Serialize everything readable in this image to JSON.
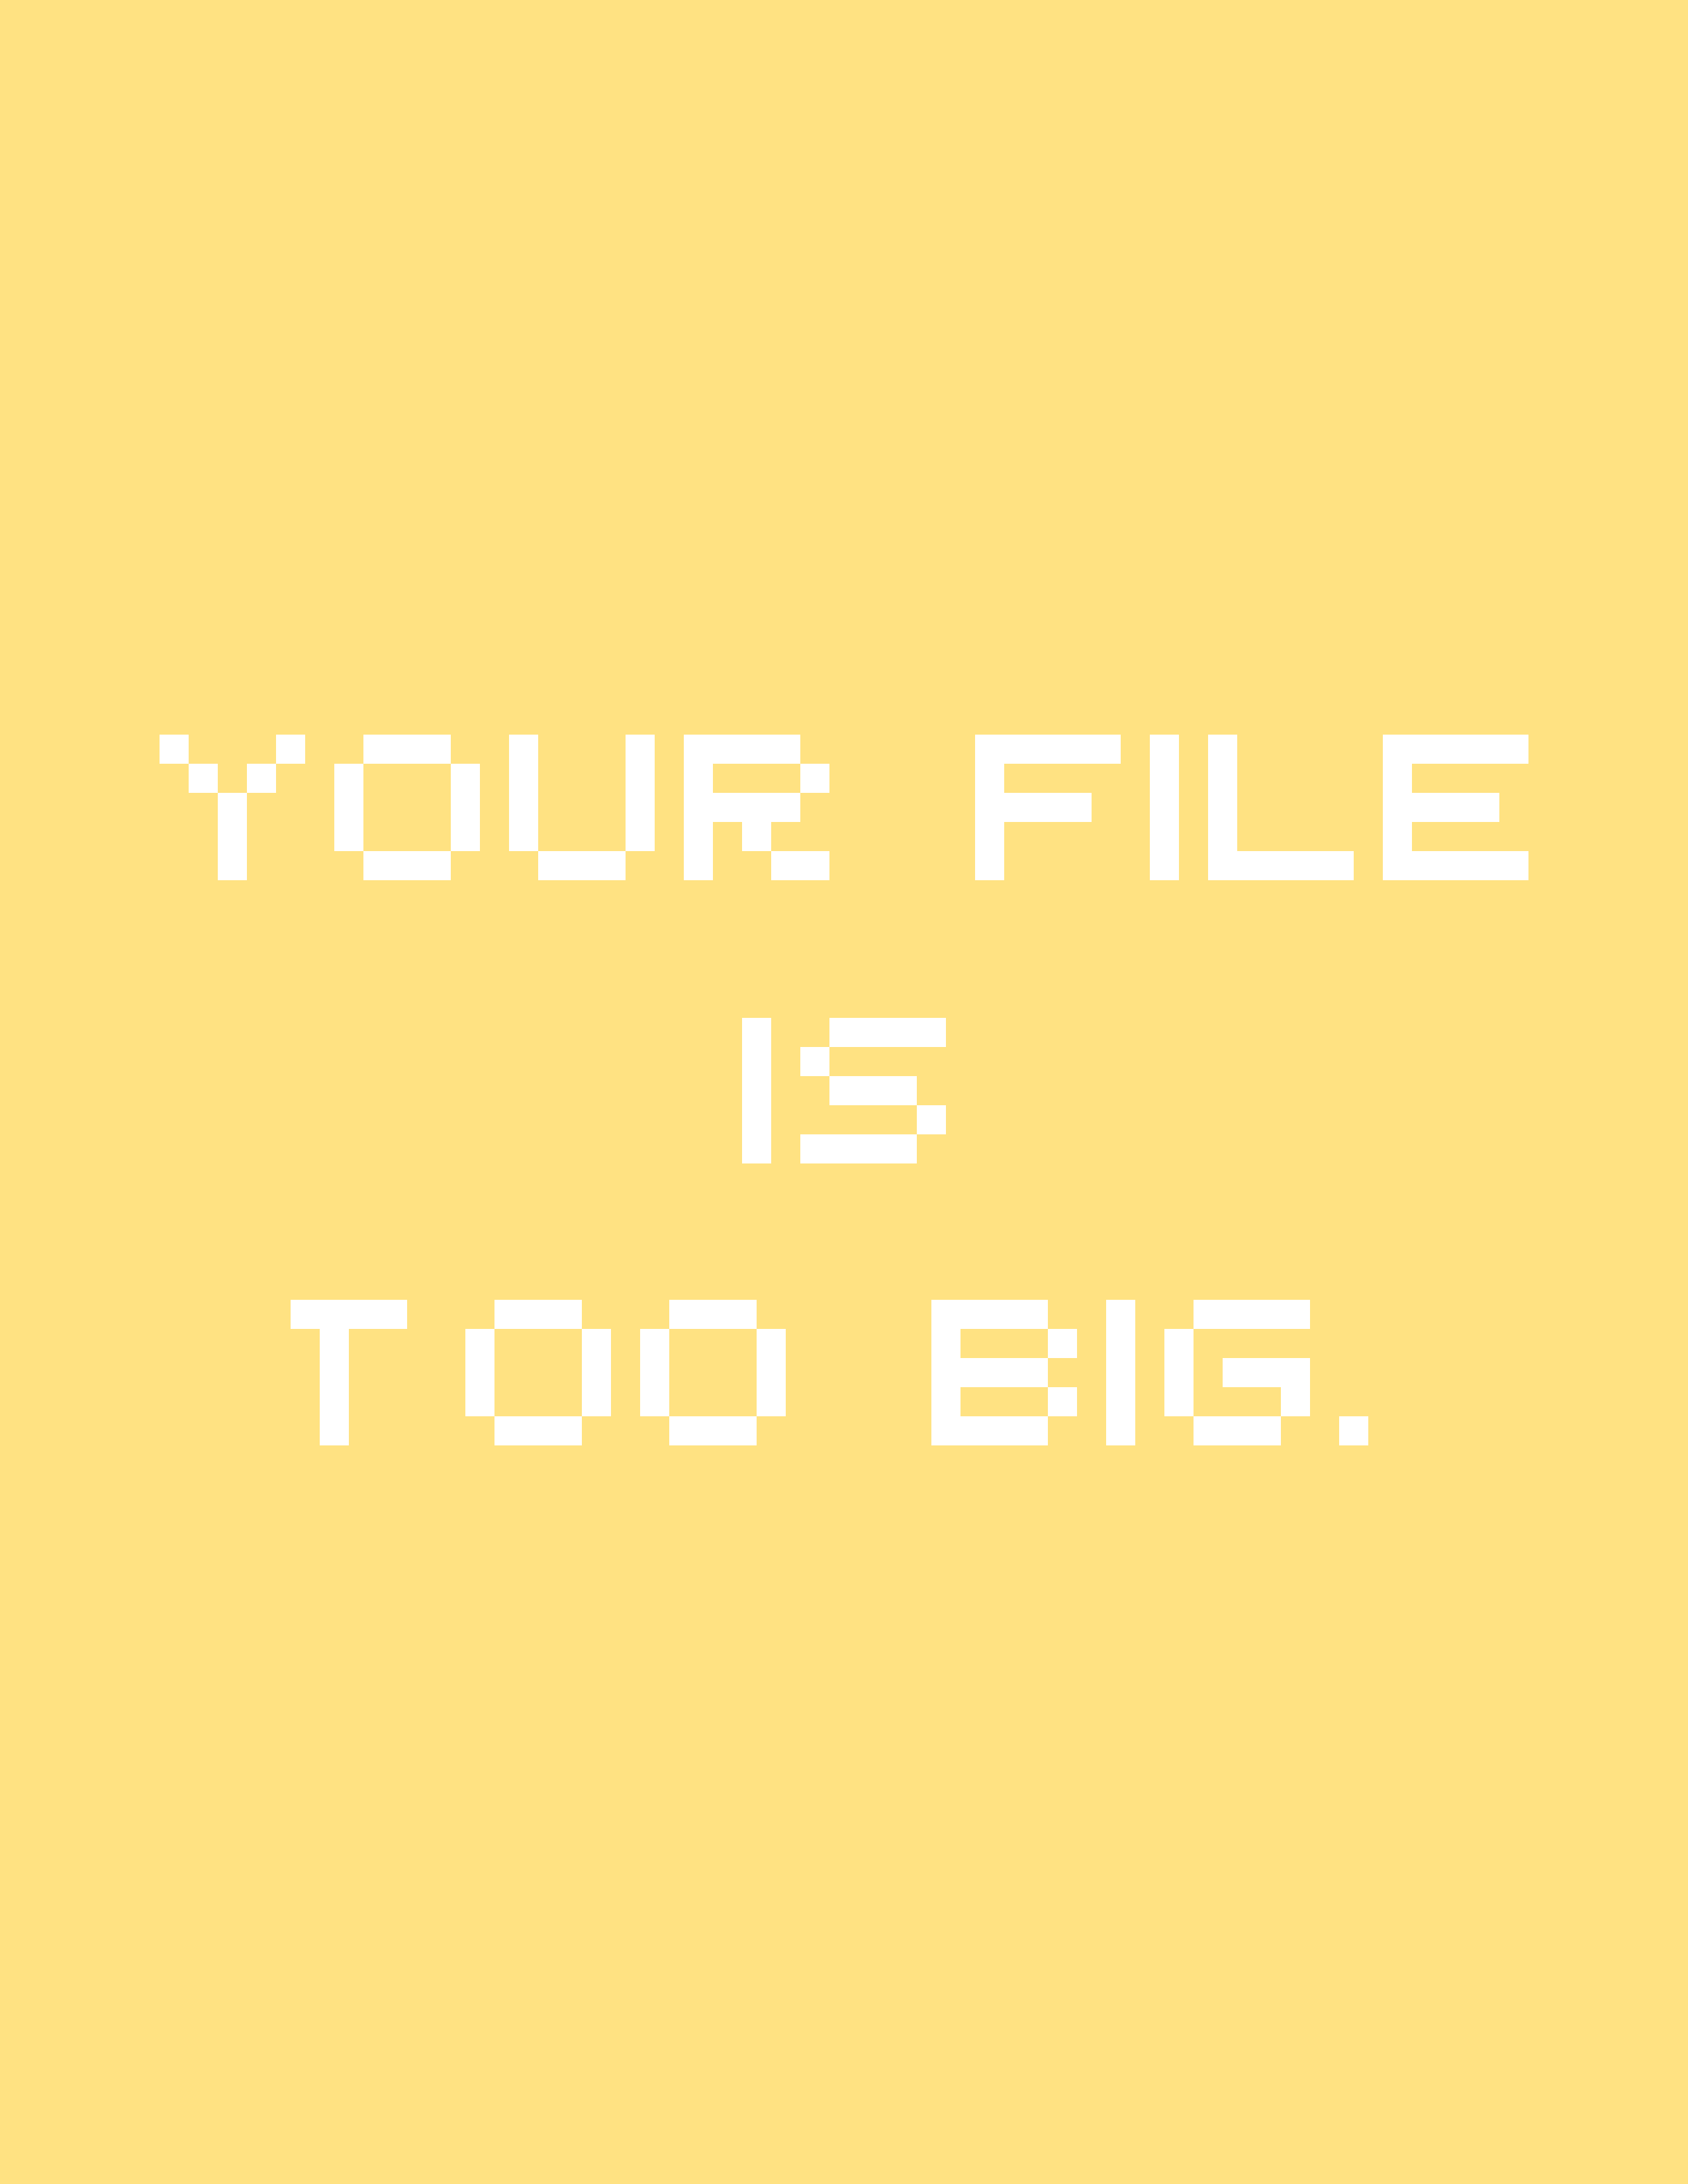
{
  "colors": {
    "background": "#FFE282",
    "text": "#FFFFFF"
  },
  "message": {
    "lines": [
      "YOUR FILE",
      "IS",
      "TOO BIG."
    ]
  }
}
